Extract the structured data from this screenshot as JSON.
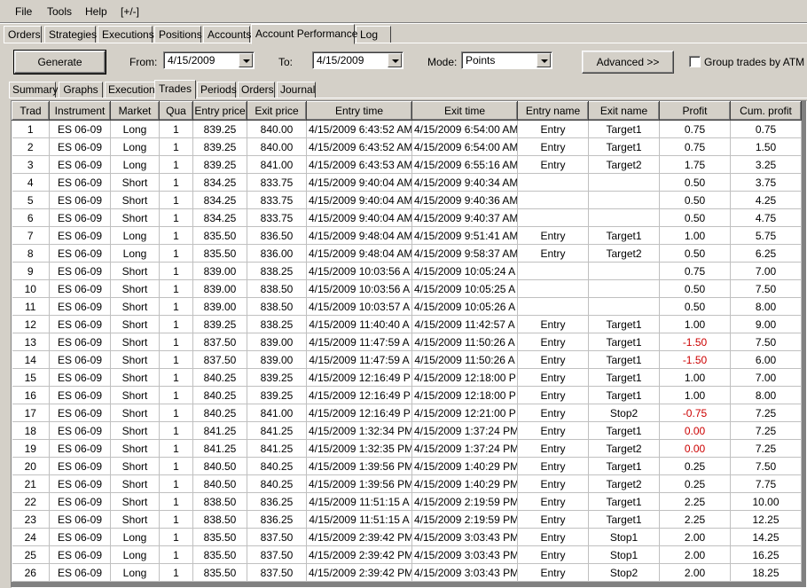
{
  "menu": [
    "File",
    "Tools",
    "Help",
    "[+/-]"
  ],
  "main_tabs": [
    "Orders",
    "Strategies",
    "Executions",
    "Positions",
    "Accounts",
    "Account Performance",
    "Log"
  ],
  "toolbar": {
    "generate_label": "Generate",
    "from_label": "From:",
    "from_value": "4/15/2009",
    "to_label": "To:",
    "to_value": "4/15/2009",
    "mode_label": "Mode:",
    "mode_value": "Points",
    "advanced_label": "Advanced >>",
    "group_label": "Group trades by ATM str"
  },
  "sub_tabs": [
    "Summary",
    "Graphs",
    "Executions",
    "Trades",
    "Periods",
    "Orders",
    "Journal"
  ],
  "table": {
    "headers": [
      "Trad",
      "Instrument",
      "Market",
      "Qua",
      "Entry price",
      "Exit price",
      "Entry time",
      "Exit time",
      "Entry name",
      "Exit name",
      "Profit",
      "Cum. profit"
    ],
    "rows": [
      [
        "1",
        "ES 06-09",
        "Long",
        "1",
        "839.25",
        "840.00",
        "4/15/2009 6:43:52 AM",
        "4/15/2009 6:54:00 AM",
        "Entry",
        "Target1",
        "0.75",
        "0.75"
      ],
      [
        "2",
        "ES 06-09",
        "Long",
        "1",
        "839.25",
        "840.00",
        "4/15/2009 6:43:52 AM",
        "4/15/2009 6:54:00 AM",
        "Entry",
        "Target1",
        "0.75",
        "1.50"
      ],
      [
        "3",
        "ES 06-09",
        "Long",
        "1",
        "839.25",
        "841.00",
        "4/15/2009 6:43:53 AM",
        "4/15/2009 6:55:16 AM",
        "Entry",
        "Target2",
        "1.75",
        "3.25"
      ],
      [
        "4",
        "ES 06-09",
        "Short",
        "1",
        "834.25",
        "833.75",
        "4/15/2009 9:40:04 AM",
        "4/15/2009 9:40:34 AM",
        "",
        "",
        "0.50",
        "3.75"
      ],
      [
        "5",
        "ES 06-09",
        "Short",
        "1",
        "834.25",
        "833.75",
        "4/15/2009 9:40:04 AM",
        "4/15/2009 9:40:36 AM",
        "",
        "",
        "0.50",
        "4.25"
      ],
      [
        "6",
        "ES 06-09",
        "Short",
        "1",
        "834.25",
        "833.75",
        "4/15/2009 9:40:04 AM",
        "4/15/2009 9:40:37 AM",
        "",
        "",
        "0.50",
        "4.75"
      ],
      [
        "7",
        "ES 06-09",
        "Long",
        "1",
        "835.50",
        "836.50",
        "4/15/2009 9:48:04 AM",
        "4/15/2009 9:51:41 AM",
        "Entry",
        "Target1",
        "1.00",
        "5.75"
      ],
      [
        "8",
        "ES 06-09",
        "Long",
        "1",
        "835.50",
        "836.00",
        "4/15/2009 9:48:04 AM",
        "4/15/2009 9:58:37 AM",
        "Entry",
        "Target2",
        "0.50",
        "6.25"
      ],
      [
        "9",
        "ES 06-09",
        "Short",
        "1",
        "839.00",
        "838.25",
        "4/15/2009 10:03:56 A",
        "4/15/2009 10:05:24 A",
        "",
        "",
        "0.75",
        "7.00"
      ],
      [
        "10",
        "ES 06-09",
        "Short",
        "1",
        "839.00",
        "838.50",
        "4/15/2009 10:03:56 A",
        "4/15/2009 10:05:25 A",
        "",
        "",
        "0.50",
        "7.50"
      ],
      [
        "11",
        "ES 06-09",
        "Short",
        "1",
        "839.00",
        "838.50",
        "4/15/2009 10:03:57 A",
        "4/15/2009 10:05:26 A",
        "",
        "",
        "0.50",
        "8.00"
      ],
      [
        "12",
        "ES 06-09",
        "Short",
        "1",
        "839.25",
        "838.25",
        "4/15/2009 11:40:40 A",
        "4/15/2009 11:42:57 A",
        "Entry",
        "Target1",
        "1.00",
        "9.00"
      ],
      [
        "13",
        "ES 06-09",
        "Short",
        "1",
        "837.50",
        "839.00",
        "4/15/2009 11:47:59 A",
        "4/15/2009 11:50:26 A",
        "Entry",
        "Target1",
        "-1.50",
        "7.50"
      ],
      [
        "14",
        "ES 06-09",
        "Short",
        "1",
        "837.50",
        "839.00",
        "4/15/2009 11:47:59 A",
        "4/15/2009 11:50:26 A",
        "Entry",
        "Target1",
        "-1.50",
        "6.00"
      ],
      [
        "15",
        "ES 06-09",
        "Short",
        "1",
        "840.25",
        "839.25",
        "4/15/2009 12:16:49 P",
        "4/15/2009 12:18:00 P",
        "Entry",
        "Target1",
        "1.00",
        "7.00"
      ],
      [
        "16",
        "ES 06-09",
        "Short",
        "1",
        "840.25",
        "839.25",
        "4/15/2009 12:16:49 P",
        "4/15/2009 12:18:00 P",
        "Entry",
        "Target1",
        "1.00",
        "8.00"
      ],
      [
        "17",
        "ES 06-09",
        "Short",
        "1",
        "840.25",
        "841.00",
        "4/15/2009 12:16:49 P",
        "4/15/2009 12:21:00 P",
        "Entry",
        "Stop2",
        "-0.75",
        "7.25"
      ],
      [
        "18",
        "ES 06-09",
        "Short",
        "1",
        "841.25",
        "841.25",
        "4/15/2009 1:32:34 PM",
        "4/15/2009 1:37:24 PM",
        "Entry",
        "Target1",
        "0.00",
        "7.25"
      ],
      [
        "19",
        "ES 06-09",
        "Short",
        "1",
        "841.25",
        "841.25",
        "4/15/2009 1:32:35 PM",
        "4/15/2009 1:37:24 PM",
        "Entry",
        "Target2",
        "0.00",
        "7.25"
      ],
      [
        "20",
        "ES 06-09",
        "Short",
        "1",
        "840.50",
        "840.25",
        "4/15/2009 1:39:56 PM",
        "4/15/2009 1:40:29 PM",
        "Entry",
        "Target1",
        "0.25",
        "7.50"
      ],
      [
        "21",
        "ES 06-09",
        "Short",
        "1",
        "840.50",
        "840.25",
        "4/15/2009 1:39:56 PM",
        "4/15/2009 1:40:29 PM",
        "Entry",
        "Target2",
        "0.25",
        "7.75"
      ],
      [
        "22",
        "ES 06-09",
        "Short",
        "1",
        "838.50",
        "836.25",
        "4/15/2009 11:51:15 A",
        "4/15/2009 2:19:59 PM",
        "Entry",
        "Target1",
        "2.25",
        "10.00"
      ],
      [
        "23",
        "ES 06-09",
        "Short",
        "1",
        "838.50",
        "836.25",
        "4/15/2009 11:51:15 A",
        "4/15/2009 2:19:59 PM",
        "Entry",
        "Target1",
        "2.25",
        "12.25"
      ],
      [
        "24",
        "ES 06-09",
        "Long",
        "1",
        "835.50",
        "837.50",
        "4/15/2009 2:39:42 PM",
        "4/15/2009 3:03:43 PM",
        "Entry",
        "Stop1",
        "2.00",
        "14.25"
      ],
      [
        "25",
        "ES 06-09",
        "Long",
        "1",
        "835.50",
        "837.50",
        "4/15/2009 2:39:42 PM",
        "4/15/2009 3:03:43 PM",
        "Entry",
        "Stop1",
        "2.00",
        "16.25"
      ],
      [
        "26",
        "ES 06-09",
        "Long",
        "1",
        "835.50",
        "837.50",
        "4/15/2009 2:39:42 PM",
        "4/15/2009 3:03:43 PM",
        "Entry",
        "Stop2",
        "2.00",
        "18.25"
      ]
    ]
  },
  "colors": {
    "negative_profit": "#cc0000",
    "window_bg": "#d4d0c8"
  }
}
